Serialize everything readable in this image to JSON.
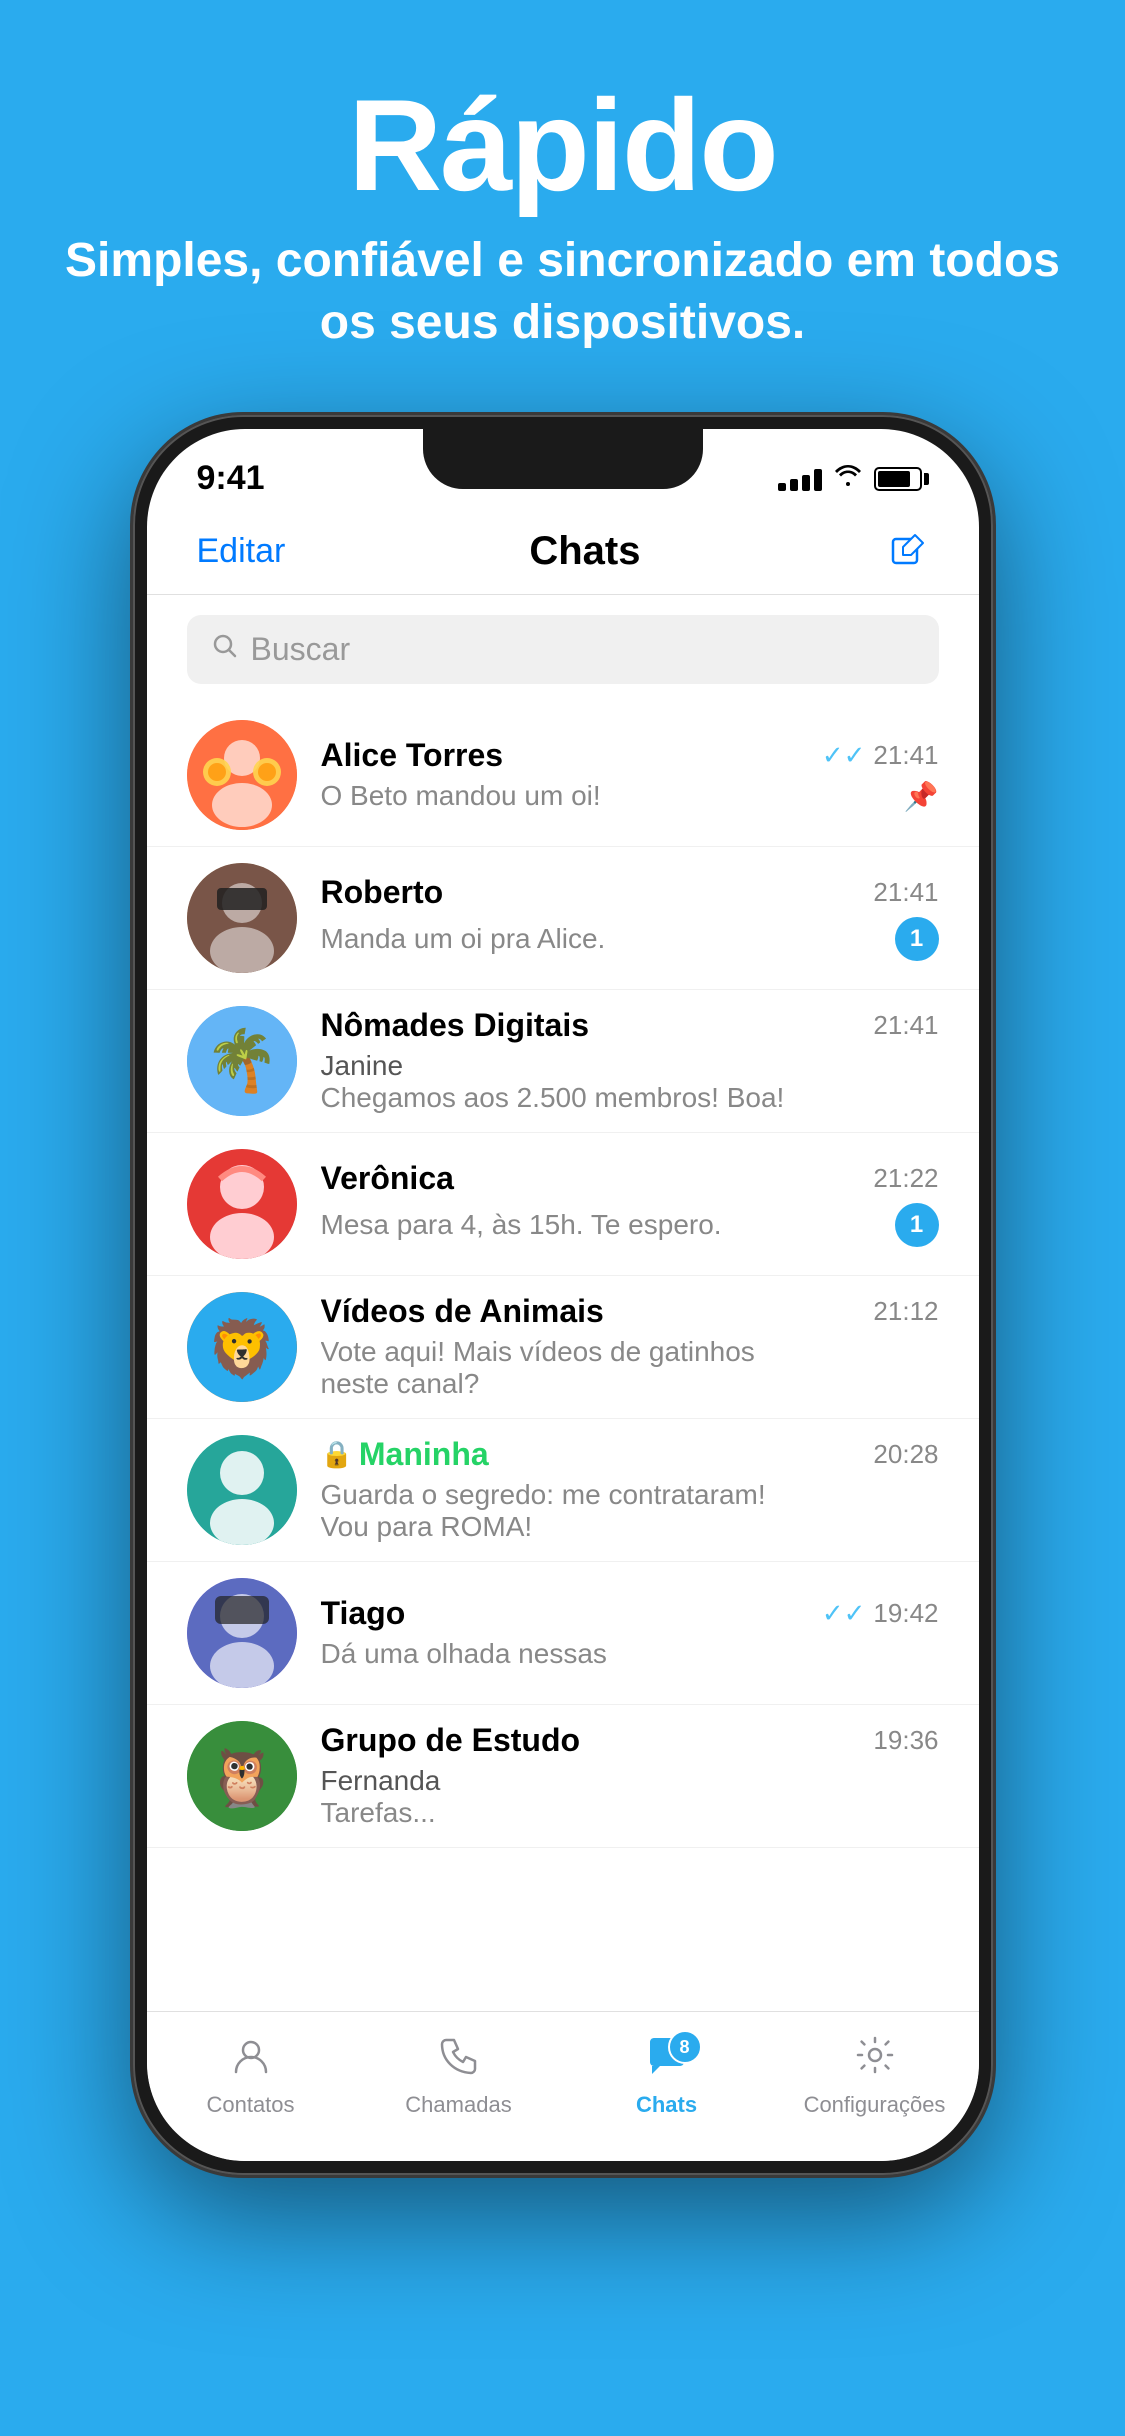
{
  "hero": {
    "title": "Rápido",
    "subtitle": "Simples, confiável e sincronizado em todos os seus dispositivos."
  },
  "statusBar": {
    "time": "9:41",
    "signalLabel": "signal",
    "wifiLabel": "wifi",
    "batteryLabel": "battery"
  },
  "appHeader": {
    "editLabel": "Editar",
    "title": "Chats",
    "composeLabel": "compose"
  },
  "search": {
    "placeholder": "Buscar"
  },
  "chats": [
    {
      "id": "alice",
      "name": "Alice Torres",
      "preview": "O Beto mandou um oi!",
      "time": "21:41",
      "timeColor": "gray",
      "hasDoubleCheck": true,
      "checkColor": "blue",
      "hasBadge": false,
      "hasPin": true,
      "senderLabel": "",
      "secondLine": ""
    },
    {
      "id": "roberto",
      "name": "Roberto",
      "preview": "Manda um oi pra Alice.",
      "time": "21:41",
      "timeColor": "gray",
      "hasDoubleCheck": false,
      "hasBadge": true,
      "badgeCount": "1",
      "hasPin": false,
      "senderLabel": "",
      "secondLine": ""
    },
    {
      "id": "nomades",
      "name": "Nômades Digitais",
      "senderLabel": "Janine",
      "preview": "Chegamos aos 2.500 membros! Boa!",
      "time": "21:41",
      "timeColor": "gray",
      "hasDoubleCheck": false,
      "hasBadge": false,
      "hasPin": false,
      "secondLine": ""
    },
    {
      "id": "veronica",
      "name": "Verônica",
      "preview": "Mesa para 4, às 15h. Te espero.",
      "time": "21:22",
      "timeColor": "gray",
      "hasDoubleCheck": false,
      "hasBadge": true,
      "badgeCount": "1",
      "hasPin": false,
      "senderLabel": "",
      "secondLine": ""
    },
    {
      "id": "videos",
      "name": "Vídeos de Animais",
      "preview": "Vote aqui! Mais vídeos de gatinhos",
      "secondLine": "neste canal?",
      "time": "21:12",
      "timeColor": "gray",
      "hasDoubleCheck": false,
      "hasBadge": false,
      "hasPin": false,
      "senderLabel": ""
    },
    {
      "id": "maninha",
      "name": "Maninha",
      "nameColor": "green",
      "hasLock": true,
      "preview": "Guarda o segredo: me contrataram!",
      "secondLine": "Vou para ROMA!",
      "time": "20:28",
      "timeColor": "gray",
      "hasDoubleCheck": false,
      "hasBadge": false,
      "hasPin": false,
      "senderLabel": ""
    },
    {
      "id": "tiago",
      "name": "Tiago",
      "preview": "Dá uma olhada nessas",
      "time": "19:42",
      "timeColor": "gray",
      "hasDoubleCheck": true,
      "checkColor": "blue",
      "hasBadge": false,
      "hasPin": false,
      "senderLabel": "",
      "secondLine": ""
    },
    {
      "id": "grupo",
      "name": "Grupo de Estudo",
      "senderLabel": "Fernanda",
      "preview": "Tarefas...",
      "time": "19:36",
      "timeColor": "gray",
      "hasDoubleCheck": false,
      "hasBadge": false,
      "hasPin": false,
      "secondLine": ""
    }
  ],
  "tabBar": {
    "tabs": [
      {
        "id": "contacts",
        "label": "Contatos",
        "icon": "person",
        "active": false
      },
      {
        "id": "calls",
        "label": "Chamadas",
        "icon": "phone",
        "active": false
      },
      {
        "id": "chats",
        "label": "Chats",
        "icon": "chat",
        "active": true,
        "badge": "8"
      },
      {
        "id": "settings",
        "label": "Configurações",
        "icon": "gear",
        "active": false
      }
    ]
  }
}
